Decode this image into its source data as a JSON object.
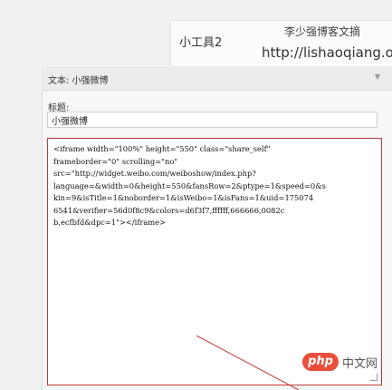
{
  "preview": {
    "tool_label": "小工具2",
    "blog_name": "李少强博客文摘",
    "blog_url": "http://lishaoqiang.org"
  },
  "widget": {
    "header_title": "文本: 小强微博",
    "title_label": "标题:",
    "title_value": "小强微博",
    "code_lines": [
      "<iframe width=\"100%\" height=\"550\" class=\"share_self\"",
      "frameborder=\"0\" scrolling=\"no\"",
      "src=\"http://widget.weibo.com/weiboshow/index.php?",
      "language=&width=0&height=550&fansRow=2&ptype=1&speed=0&s",
      "kin=9&isTitle=1&noborder=1&isWeibo=1&isFans=1&uid=175074",
      "6541&verifier=56d0f8c9&colors=d6f3f7,ffffff,666666,0082c",
      "b,ecfbfd&dpc=1\"></iframe>"
    ]
  },
  "watermark": {
    "logo": "php",
    "text": "中文网"
  },
  "colors": {
    "highlight_border": "#c23a3a",
    "php_badge": "#e94e3a"
  }
}
